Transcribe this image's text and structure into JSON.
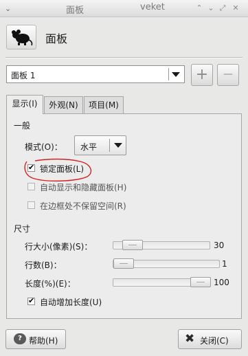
{
  "window": {
    "menu_glyph": "⌄",
    "title": "面板",
    "app_name": "veket",
    "buttons": {
      "shade": "⌃",
      "minimize": "⌄",
      "maximize": "⤢",
      "close": "✕"
    }
  },
  "header": {
    "title": "面板",
    "icon": "mouse-icon"
  },
  "panel_selector": {
    "selected": "面板 1",
    "add_label": "+",
    "remove_label": "—"
  },
  "tabs": [
    {
      "label": "显示(I)",
      "active": true
    },
    {
      "label": "外观(N)",
      "active": false
    },
    {
      "label": "项目(M)",
      "active": false
    }
  ],
  "general": {
    "heading": "一般",
    "mode_label": "模式(O)：",
    "mode_value": "水平",
    "lock_label": "锁定面板(L)",
    "lock_checked": true,
    "autohide_label": "自动显示和隐藏面板(H)",
    "autohide_checked": false,
    "noreserve_label": "在边框处不保留空间(R)",
    "noreserve_checked": false
  },
  "size": {
    "heading": "尺寸",
    "row_size_label": "行大小(像素)(S)：",
    "row_size_value": "30",
    "rows_label": "行数(B)：",
    "rows_value": "1",
    "length_label": "长度(%)(E)：",
    "length_value": "100",
    "autogrow_label": "自动增加长度(U)",
    "autogrow_checked": true
  },
  "footer": {
    "help_label": "帮助(H)",
    "close_label": "关闭(C)"
  },
  "colors": {
    "annotation": "#d42020"
  }
}
